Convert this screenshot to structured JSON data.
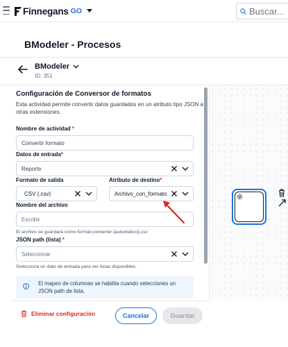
{
  "topbar": {
    "logo_text": "Finnegans",
    "logo_suffix": "GO",
    "search_placeholder": "Buscar..."
  },
  "header": {
    "page_title": "BModeler - Procesos",
    "process_name": "BModeler",
    "process_id": "ID: 351"
  },
  "panel": {
    "title": "Configuración de Conversor de formatos",
    "description": "Esta actividad permite convertir datos guardados en un atributo tipo JSON a otras extensiones.",
    "activity_name": {
      "label": "Nombre de actividad",
      "required_mark": "*",
      "value": "Convertir formato"
    },
    "input_data": {
      "label": "Datos de entrada",
      "required_mark": "*",
      "value": "Reporte"
    },
    "output_format": {
      "label": "Formato de salida",
      "value": "CSV (.csv)"
    },
    "target_attribute": {
      "label": "Atributo de destino",
      "required_mark": "*",
      "value": "Archivo_con_formato"
    },
    "file_name": {
      "label": "Nombre del archivo",
      "placeholder": "Escribir",
      "hint": "El archivo se guardará como format-converter-[automático].csv"
    },
    "json_path": {
      "label": "JSON path (lista)",
      "required_mark": "*",
      "placeholder": "Seleccionar",
      "hint": "Selecciona un dato de entrada para ver listas disponibles."
    },
    "info_message": "El mapeo de columnas se habilita cuando selecciones un JSON path de lista."
  },
  "footer": {
    "delete_label": "Eliminar configuración",
    "cancel_label": "Cancelar",
    "save_label": "Guardar"
  },
  "colors": {
    "brand": "#1e6fd9",
    "danger": "#dc2626",
    "info_bg": "#eef5fd",
    "disabled_bg": "#e5e7eb"
  },
  "icons": [
    "hamburger-icon",
    "finnegans-logo-icon",
    "chevron-down-icon",
    "search-icon",
    "back-arrow-icon",
    "clear-icon",
    "info-icon",
    "trash-icon",
    "gear-icon",
    "connect-arrow-icon"
  ]
}
